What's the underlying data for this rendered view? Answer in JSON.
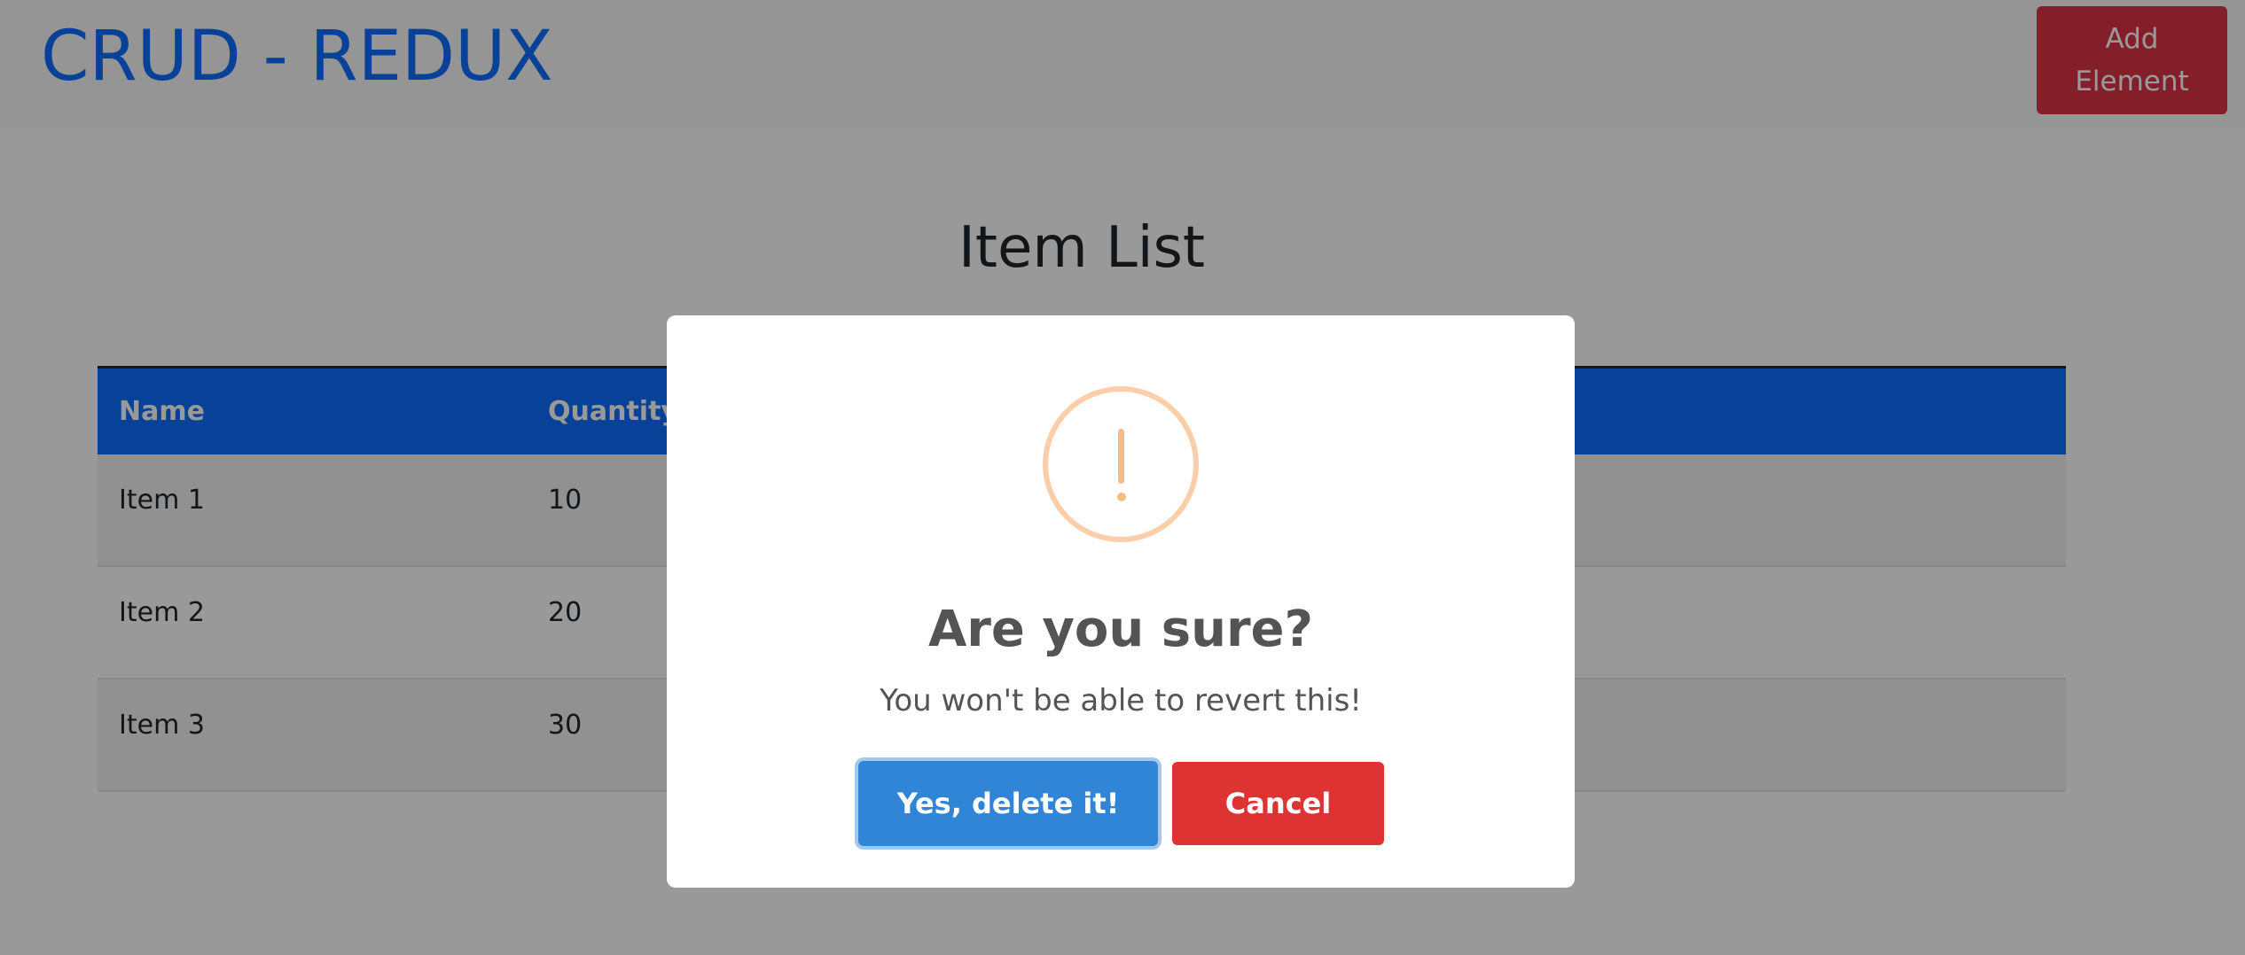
{
  "navbar": {
    "brand": "CRUD - REDUX",
    "add_button_label": "Add\nElement"
  },
  "main": {
    "title": "Item List",
    "table": {
      "columns": [
        "Name",
        "Quantity"
      ],
      "rows": [
        {
          "name": "Item 1",
          "quantity": "10"
        },
        {
          "name": "Item 2",
          "quantity": "20"
        },
        {
          "name": "Item 3",
          "quantity": "30"
        }
      ]
    }
  },
  "modal": {
    "icon": "warning-exclamation-icon",
    "title": "Are you sure?",
    "text": "You won't be able to revert this!",
    "confirm_label": "Yes, delete it!",
    "cancel_label": "Cancel"
  },
  "colors": {
    "primary": "#0d6efd",
    "danger": "#dc3545",
    "confirm": "#3085d6",
    "cancel": "#dd3333",
    "warning_icon": "#f8bb86"
  }
}
